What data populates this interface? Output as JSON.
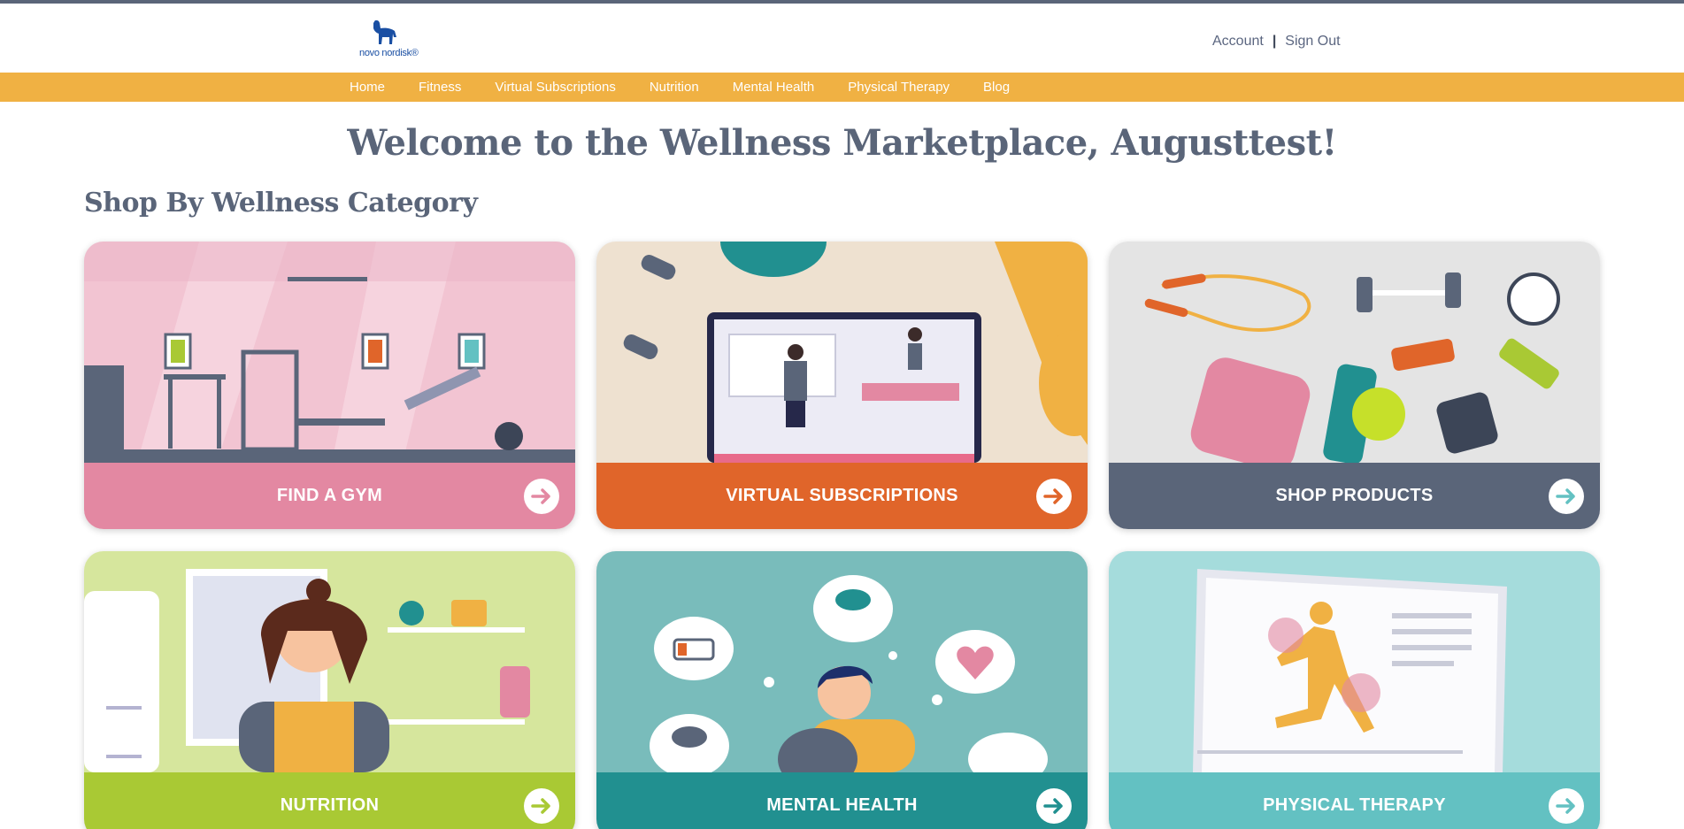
{
  "brand": {
    "logo_text": "novo nordisk®"
  },
  "header": {
    "account_label": "Account",
    "separator": "|",
    "signout_label": "Sign Out"
  },
  "nav": {
    "items": [
      "Home",
      "Fitness",
      "Virtual Subscriptions",
      "Nutrition",
      "Mental Health",
      "Physical Therapy",
      "Blog"
    ]
  },
  "main": {
    "welcome": "Welcome to the Wellness Marketplace, Augusttest!",
    "section_title": "Shop By Wellness Category"
  },
  "categories": [
    {
      "label": "FIND A GYM",
      "color": "#e388a2",
      "art_color": "#f2c4d2",
      "icon": "gym-illustration"
    },
    {
      "label": "VIRTUAL SUBSCRIPTIONS",
      "color": "#e0652a",
      "art_color": "#eee1d0",
      "icon": "laptop-workout-illustration"
    },
    {
      "label": "SHOP PRODUCTS",
      "color": "#5a6579",
      "art_color": "#e4e4e4",
      "icon": "fitness-products-illustration"
    },
    {
      "label": "NUTRITION",
      "color": "#a9c934",
      "art_color": "#d6e69d",
      "icon": "cooking-illustration"
    },
    {
      "label": "MENTAL HEALTH",
      "color": "#219090",
      "art_color": "#79bcbb",
      "icon": "mental-health-illustration"
    },
    {
      "label": "PHYSICAL THERAPY",
      "color": "#63c1c2",
      "art_color": "#a5dcdc",
      "icon": "runner-anatomy-illustration"
    }
  ],
  "icons": {
    "arrow": "arrow-right-icon"
  }
}
